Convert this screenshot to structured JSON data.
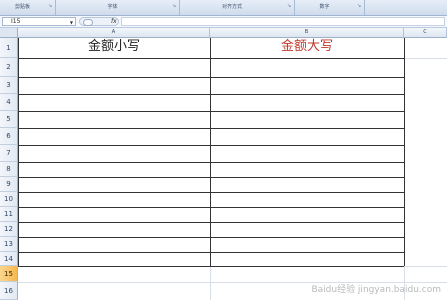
{
  "ribbon": {
    "groups": [
      {
        "label": "剪贴板"
      },
      {
        "label": "字体"
      },
      {
        "label": "对齐方式"
      },
      {
        "label": "数字"
      }
    ]
  },
  "formula_bar": {
    "name_box": "I15",
    "fx": "fx",
    "formula": ""
  },
  "columns": [
    "A",
    "B",
    "C"
  ],
  "rows": [
    "1",
    "2",
    "3",
    "4",
    "5",
    "6",
    "7",
    "8",
    "9",
    "10",
    "11",
    "12",
    "13",
    "14",
    "15",
    "16"
  ],
  "selected_row": "15",
  "cells": {
    "A1": "金额小写",
    "B1": "金额大写"
  },
  "colors": {
    "header_text_a": "#222222",
    "header_text_b": "#c0392b",
    "selected_row_header": "#f5b94e"
  },
  "watermark": "Baidu经验 jingyan.baidu.com"
}
